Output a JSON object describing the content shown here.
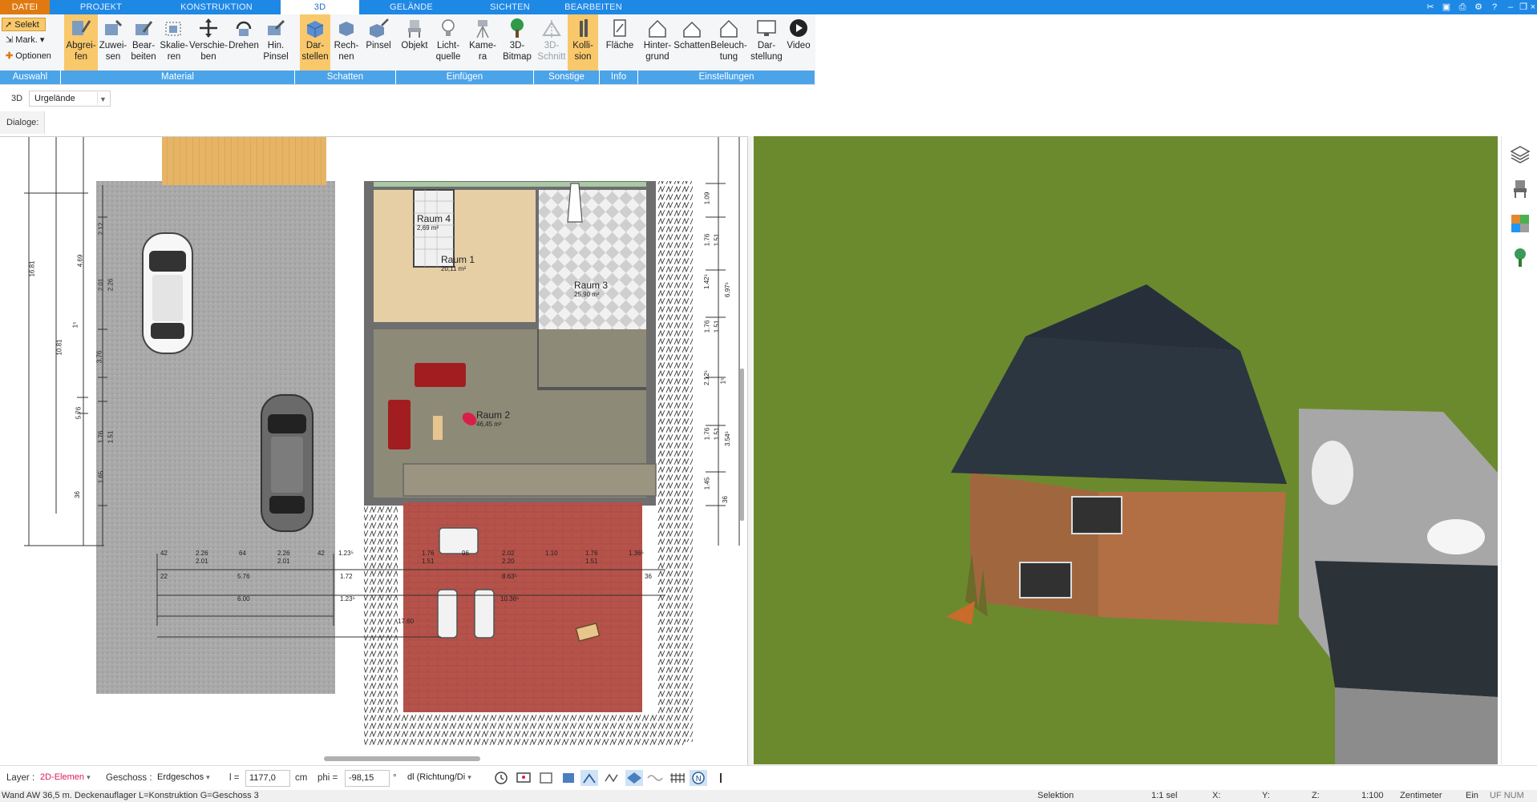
{
  "menubar": {
    "tabs": [
      "DATEI",
      "PROJEKT",
      "KONSTRUKTION",
      "3D",
      "GELÄNDE",
      "SICHTEN",
      "BEARBEITEN"
    ],
    "active": "3D"
  },
  "ribbon": {
    "selekt": "Selekt",
    "mark": "Mark.",
    "optionen": "Optionen",
    "buttons": [
      {
        "label": "Abgrei-\nfen"
      },
      {
        "label": "Zuwei-\nsen"
      },
      {
        "label": "Bear-\nbeiten"
      },
      {
        "label": "Skalie-\nren"
      },
      {
        "label": "Verschie-\nben"
      },
      {
        "label": "Drehen"
      },
      {
        "label": "Hin.\nPinsel"
      },
      {
        "label": "Dar-\nstellen"
      },
      {
        "label": "Rech-\nnen"
      },
      {
        "label": "Pinsel"
      },
      {
        "label": "Objekt"
      },
      {
        "label": "Licht-\nquelle"
      },
      {
        "label": "Kame-\nra"
      },
      {
        "label": "3D-\nBitmap"
      },
      {
        "label": "3D-\nSchnitt"
      },
      {
        "label": "Kolli-\nsion"
      },
      {
        "label": "Fläche"
      },
      {
        "label": "Hinter-\ngrund"
      },
      {
        "label": "Schatten"
      },
      {
        "label": "Beleuch-\ntung"
      },
      {
        "label": "Dar-\nstellung"
      },
      {
        "label": "Video"
      }
    ],
    "groups": [
      "Auswahl",
      "Material",
      "Schatten",
      "Einfügen",
      "Sonstige",
      "Info",
      "Einstellungen"
    ]
  },
  "viewbar": {
    "mode_label": "3D",
    "selected_view": "Urgelände",
    "dialoge_label": "Dialoge:"
  },
  "plan": {
    "rooms": [
      {
        "name": "Raum 4",
        "area": "2,69 m²"
      },
      {
        "name": "Raum 1",
        "area": "20,11 m²"
      },
      {
        "name": "Raum 3",
        "area": "25,90 m²"
      },
      {
        "name": "Raum 2",
        "area": "46,45 m²"
      }
    ],
    "dims_left": [
      "16.81",
      "10.81",
      "4.69",
      "2.01",
      "2.26",
      "1⁵",
      "3.76",
      "5.76",
      "1.76",
      "1.51",
      "1.65",
      "36",
      "2.12"
    ],
    "dims_right": [
      "1.09",
      "1.76",
      "1.51",
      "1.42⁵",
      "6.97⁵",
      "1.76",
      "1.51",
      "2.12⁵",
      "1⁵",
      "1.76",
      "1.51",
      "3.54⁵",
      "1.45",
      "36"
    ],
    "dims_bottom_row1": [
      "42",
      "2.26",
      "64",
      "2.26",
      "42",
      "1.23⁵",
      "1.76",
      "1.51",
      "96",
      "2.02",
      "1.10",
      "1.76",
      "1.51",
      "1.36⁵"
    ],
    "dims_bottom_row2": [
      "2.01",
      "2.01",
      "2.20"
    ],
    "dims_bottom_row3": [
      "22",
      "5.76",
      "1.72",
      "8.63⁵",
      "36"
    ],
    "dims_bottom_row4": [
      "6.00",
      "1.23⁵",
      "10.36⁵"
    ],
    "dims_bottom_row5": [
      "17.60"
    ]
  },
  "bottombar": {
    "layer_label": "Layer :",
    "layer_value": "2D-Elemen",
    "geschoss_label": "Geschoss :",
    "geschoss_value": "Erdgeschos",
    "l_label": "l =",
    "l_value": "1177,0",
    "l_unit": "cm",
    "phi_label": "phi =",
    "phi_value": "-98,15",
    "phi_unit": "°",
    "dl_value": "dl (Richtung/Di"
  },
  "statusbar": {
    "left": "Wand AW 36,5 m. Deckenauflager L=Konstruktion G=Geschoss 3",
    "selektion": "Selektion",
    "sel_count": "1:1 sel",
    "x_label": "X:",
    "y_label": "Y:",
    "z_label": "Z:",
    "scale": "1:100",
    "unit": "Zentimeter",
    "ein": "Ein",
    "flags": "UF NUM RF"
  },
  "colors": {
    "menubar": "#1e88e5",
    "file_tab": "#e07a10",
    "ribbon_active": "#f9c86b",
    "group_bar": "#4ba3e8",
    "grass": "#6b8a2e",
    "roof": "#2c3640",
    "wall": "#a0673f"
  }
}
